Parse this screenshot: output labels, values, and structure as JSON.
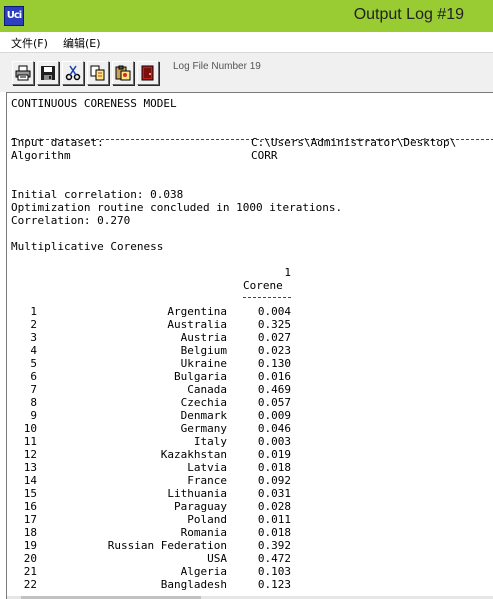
{
  "window": {
    "title": "Output Log #19",
    "app_icon_text": "Uci"
  },
  "menu": {
    "items": [
      "文件(F)",
      "编辑(E)"
    ]
  },
  "toolbar": {
    "buttons": [
      "print-icon",
      "save-icon",
      "cut-icon",
      "copy-icon",
      "paste-icon",
      "exit-icon"
    ],
    "log_label": "Log File Number 19"
  },
  "log": {
    "heading": "CONTINUOUS CORENESS MODEL",
    "input_label": "Input dataset:",
    "input_value": "C:\\Users\\Administrator\\Desktop\\",
    "algorithm_label": "Algorithm",
    "algorithm_value": "CORR",
    "initial_correlation": "Initial correlation: 0.038",
    "optimization": "Optimization routine concluded in 1000 iterations.",
    "correlation": "Correlation: 0.270",
    "section_title": "Multiplicative Coreness",
    "col_number": "1",
    "col_header": "Corene",
    "rows": [
      {
        "n": "1",
        "country": "Argentina",
        "value": "0.004"
      },
      {
        "n": "2",
        "country": "Australia",
        "value": "0.325"
      },
      {
        "n": "3",
        "country": "Austria",
        "value": "0.027"
      },
      {
        "n": "4",
        "country": "Belgium",
        "value": "0.023"
      },
      {
        "n": "5",
        "country": "Ukraine",
        "value": "0.130"
      },
      {
        "n": "6",
        "country": "Bulgaria",
        "value": "0.016"
      },
      {
        "n": "7",
        "country": "Canada",
        "value": "0.469"
      },
      {
        "n": "8",
        "country": "Czechia",
        "value": "0.057"
      },
      {
        "n": "9",
        "country": "Denmark",
        "value": "0.009"
      },
      {
        "n": "10",
        "country": "Germany",
        "value": "0.046"
      },
      {
        "n": "11",
        "country": "Italy",
        "value": "0.003"
      },
      {
        "n": "12",
        "country": "Kazakhstan",
        "value": "0.019"
      },
      {
        "n": "13",
        "country": "Latvia",
        "value": "0.018"
      },
      {
        "n": "14",
        "country": "France",
        "value": "0.092"
      },
      {
        "n": "15",
        "country": "Lithuania",
        "value": "0.031"
      },
      {
        "n": "16",
        "country": "Paraguay",
        "value": "0.028"
      },
      {
        "n": "17",
        "country": "Poland",
        "value": "0.011"
      },
      {
        "n": "18",
        "country": "Romania",
        "value": "0.018"
      },
      {
        "n": "19",
        "country": "Russian Federation",
        "value": "0.392"
      },
      {
        "n": "20",
        "country": "USA",
        "value": "0.472"
      },
      {
        "n": "21",
        "country": "Algeria",
        "value": "0.103"
      },
      {
        "n": "22",
        "country": "Bangladesh",
        "value": "0.123"
      }
    ]
  }
}
